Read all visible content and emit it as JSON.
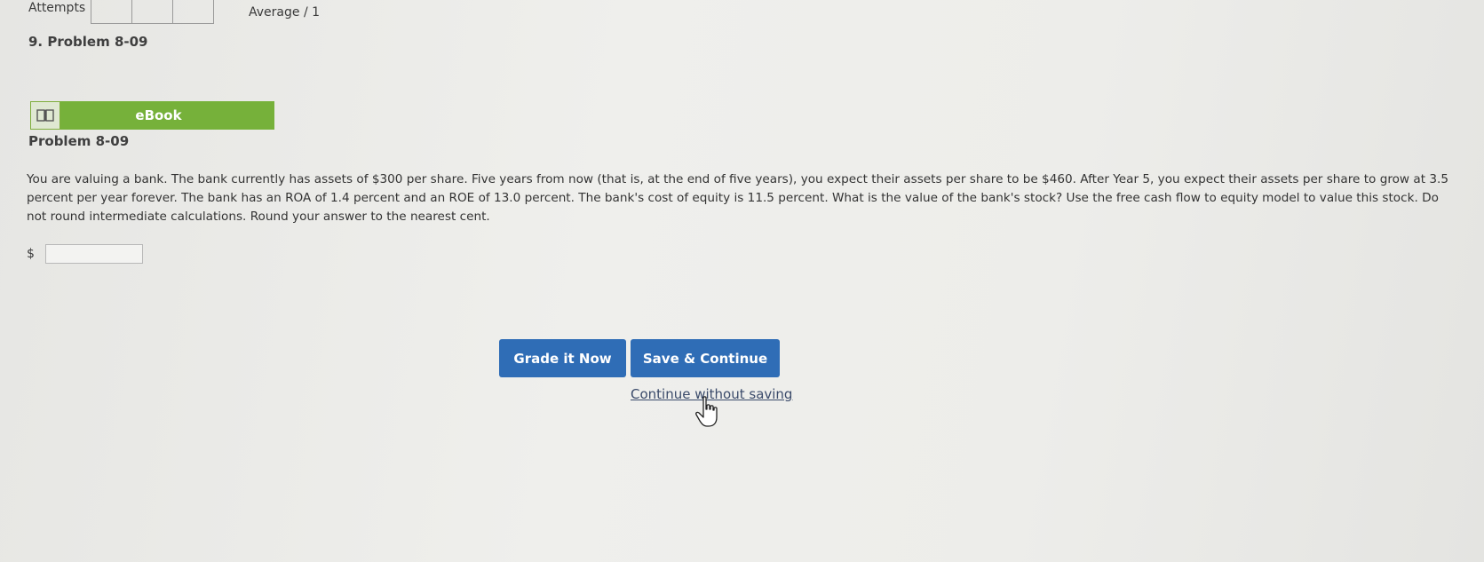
{
  "header": {
    "attempts_label": "Attempts",
    "average_label": "Average / 1"
  },
  "problem": {
    "heading": "9.  Problem 8-09",
    "ebook_label": "eBook",
    "subtitle": "Problem 8-09",
    "text": "You are valuing a bank. The bank currently has assets of $300 per share. Five years from now (that is, at the end of five years), you expect their assets per share to be $460. After Year 5, you expect their assets per share to grow at 3.5 percent per year forever. The bank has an ROA of 1.4 percent and an ROE of 13.0 percent. The bank's cost of equity is 11.5 percent. What is the value of the bank's stock? Use the free cash flow to equity model to value this stock. Do not round intermediate calculations. Round your answer to the nearest cent.",
    "currency_symbol": "$",
    "answer_value": ""
  },
  "actions": {
    "grade_label": "Grade it Now",
    "save_label": "Save & Continue",
    "continue_label": "Continue without saving"
  },
  "colors": {
    "ebook_green": "#76b13a",
    "button_blue": "#2f6db6"
  }
}
